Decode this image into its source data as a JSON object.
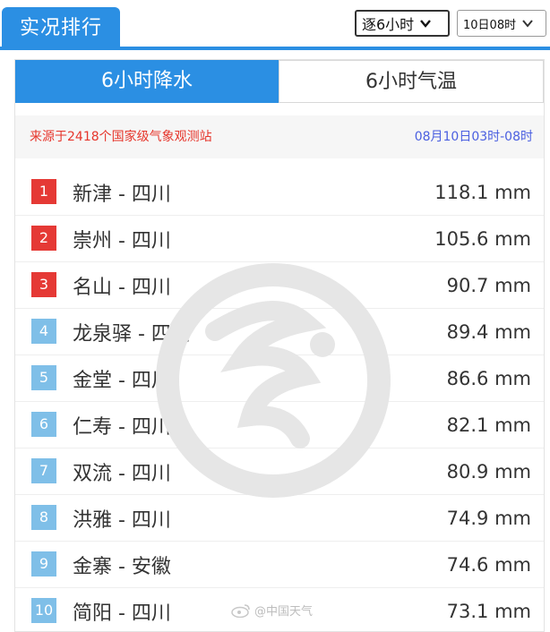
{
  "header": {
    "title": "实况排行",
    "interval_select": "逐6小时",
    "time_select": "10日08时"
  },
  "tabs": [
    {
      "label": "6小时降水",
      "active": true
    },
    {
      "label": "6小时气温",
      "active": false
    }
  ],
  "info": {
    "source": "来源于2418个国家级气象观测站",
    "period": "08月10日03时-08时"
  },
  "ranking": [
    {
      "rank": "1",
      "name": "新津 - 四川",
      "value": "118.1 mm"
    },
    {
      "rank": "2",
      "name": "崇州 - 四川",
      "value": "105.6 mm"
    },
    {
      "rank": "3",
      "name": "名山 - 四川",
      "value": "90.7 mm"
    },
    {
      "rank": "4",
      "name": "龙泉驿 - 四川",
      "value": "89.4 mm"
    },
    {
      "rank": "5",
      "name": "金堂 - 四川",
      "value": "86.6 mm"
    },
    {
      "rank": "6",
      "name": "仁寿 - 四川",
      "value": "82.1 mm"
    },
    {
      "rank": "7",
      "name": "双流 - 四川",
      "value": "80.9 mm"
    },
    {
      "rank": "8",
      "name": "洪雅 - 四川",
      "value": "74.9 mm"
    },
    {
      "rank": "9",
      "name": "金寨 - 安徽",
      "value": "74.6 mm"
    },
    {
      "rank": "10",
      "name": "简阳 - 四川",
      "value": "73.1 mm"
    }
  ],
  "watermark": {
    "text": "@中国天气",
    "icon": "weibo-icon"
  },
  "colors": {
    "accent": "#2b8fe3",
    "top_rank": "#e53935",
    "rank": "#7fbfe8",
    "source_text": "#e6352b",
    "period_text": "#4a5fe0"
  }
}
